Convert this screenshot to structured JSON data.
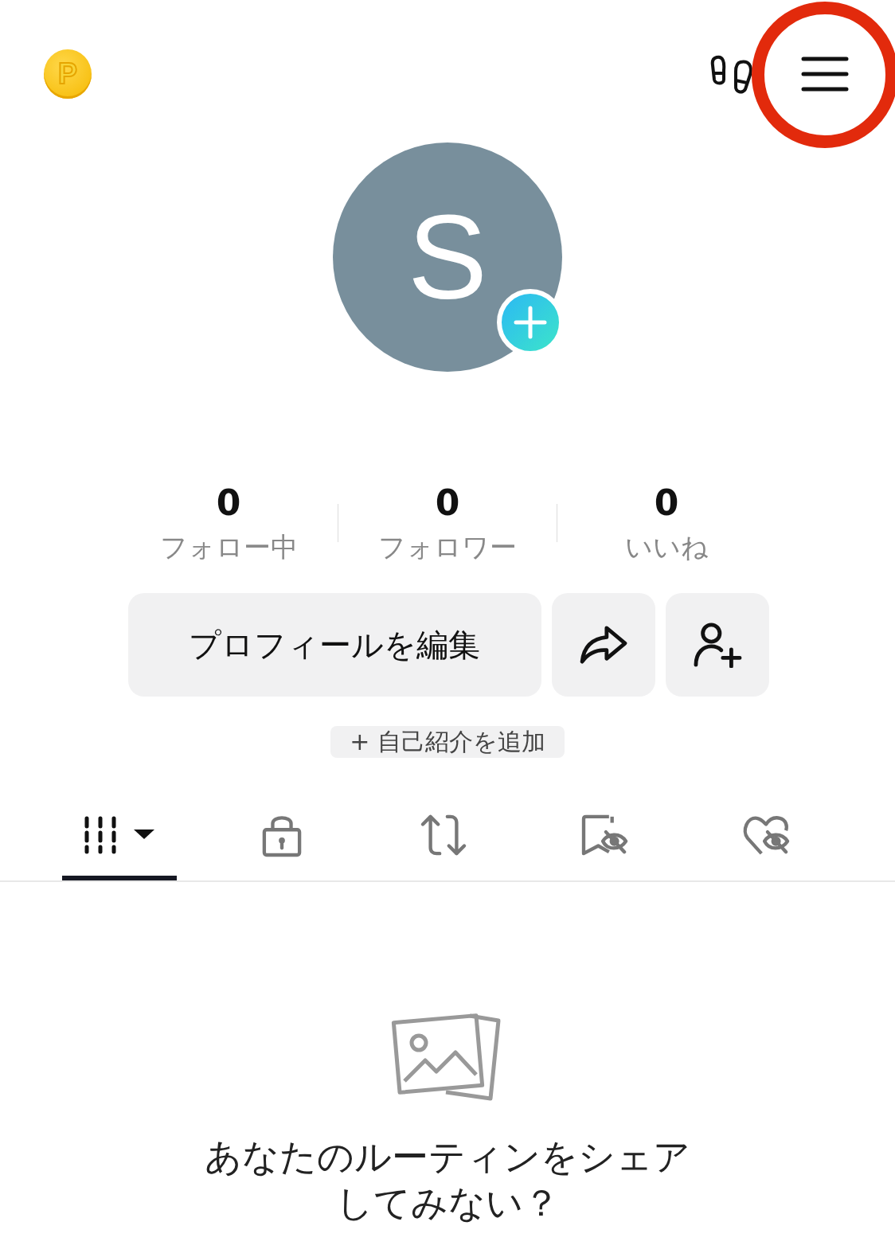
{
  "header": {
    "coin_label": "P",
    "highlighted_menu": true
  },
  "avatar": {
    "initial": "S"
  },
  "stats": [
    {
      "value": "0",
      "label": "フォロー中"
    },
    {
      "value": "0",
      "label": "フォロワー"
    },
    {
      "value": "0",
      "label": "いいね"
    }
  ],
  "actions": {
    "edit_profile": "プロフィールを編集"
  },
  "bio_button": "+ 自己紹介を追加",
  "tabs": [
    {
      "kind": "videos",
      "selected": true
    },
    {
      "kind": "private",
      "selected": false
    },
    {
      "kind": "reposts",
      "selected": false
    },
    {
      "kind": "favorites",
      "selected": false
    },
    {
      "kind": "liked",
      "selected": false
    }
  ],
  "empty_state": {
    "lines": [
      "あなたのルーティンをシェア",
      "してみない？"
    ]
  }
}
